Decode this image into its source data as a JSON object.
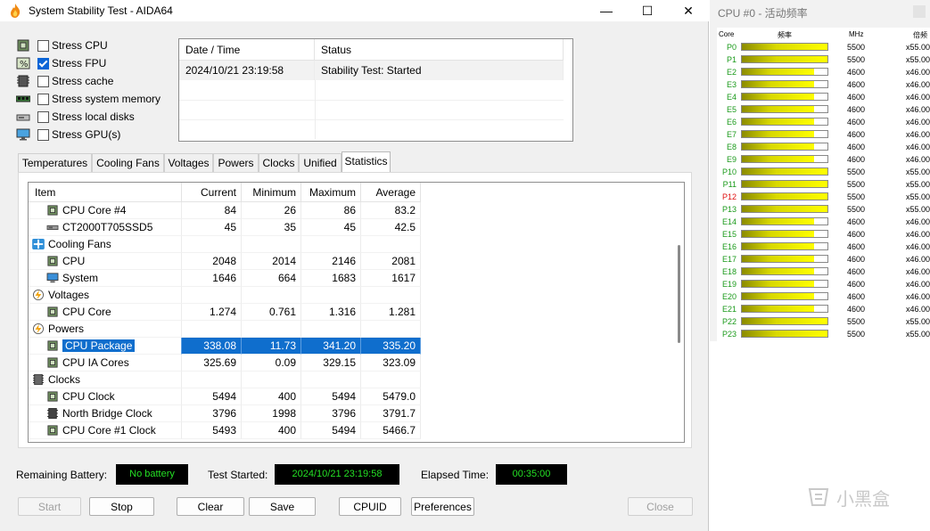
{
  "window": {
    "title": "System Stability Test - AIDA64",
    "minimize": "—",
    "maximize": "☐",
    "close": "✕"
  },
  "stress": [
    {
      "label": "Stress CPU",
      "checked": false,
      "icon": "cpu-chip-icon"
    },
    {
      "label": "Stress FPU",
      "checked": true,
      "icon": "fpu-percent-icon"
    },
    {
      "label": "Stress cache",
      "checked": false,
      "icon": "cache-chip-icon"
    },
    {
      "label": "Stress system memory",
      "checked": false,
      "icon": "memory-module-icon"
    },
    {
      "label": "Stress local disks",
      "checked": false,
      "icon": "disk-drive-icon"
    },
    {
      "label": "Stress GPU(s)",
      "checked": false,
      "icon": "monitor-gpu-icon"
    }
  ],
  "status_table": {
    "headers": [
      "Date / Time",
      "Status"
    ],
    "rows": [
      {
        "datetime": "2024/10/21 23:19:58",
        "status": "Stability Test: Started"
      }
    ]
  },
  "tabs": [
    "Temperatures",
    "Cooling Fans",
    "Voltages",
    "Powers",
    "Clocks",
    "Unified",
    "Statistics"
  ],
  "active_tab": "Statistics",
  "stats": {
    "headers": [
      "Item",
      "Current",
      "Minimum",
      "Maximum",
      "Average"
    ],
    "rows": [
      {
        "kind": "item",
        "icon": "cpu-chip-icon",
        "item": "CPU Core #4",
        "current": "84",
        "min": "26",
        "max": "86",
        "avg": "83.2"
      },
      {
        "kind": "item",
        "icon": "ssd-icon",
        "item": "CT2000T705SSD5",
        "current": "45",
        "min": "35",
        "max": "45",
        "avg": "42.5"
      },
      {
        "kind": "group",
        "icon": "fan-icon",
        "item": "Cooling Fans"
      },
      {
        "kind": "item",
        "icon": "cpu-chip-icon",
        "item": "CPU",
        "current": "2048",
        "min": "2014",
        "max": "2146",
        "avg": "2081"
      },
      {
        "kind": "item",
        "icon": "system-monitor-icon",
        "item": "System",
        "current": "1646",
        "min": "664",
        "max": "1683",
        "avg": "1617"
      },
      {
        "kind": "group",
        "icon": "voltage-bolt-icon",
        "item": "Voltages"
      },
      {
        "kind": "item",
        "icon": "cpu-chip-icon",
        "item": "CPU Core",
        "current": "1.274",
        "min": "0.761",
        "max": "1.316",
        "avg": "1.281"
      },
      {
        "kind": "group",
        "icon": "power-bolt-icon",
        "item": "Powers"
      },
      {
        "kind": "item",
        "icon": "cpu-chip-icon",
        "item": "CPU Package",
        "current": "338.08",
        "min": "11.73",
        "max": "341.20",
        "avg": "335.20",
        "selected": true
      },
      {
        "kind": "item",
        "icon": "cpu-chip-icon",
        "item": "CPU IA Cores",
        "current": "325.69",
        "min": "0.09",
        "max": "329.15",
        "avg": "323.09"
      },
      {
        "kind": "group",
        "icon": "clock-chip-icon",
        "item": "Clocks"
      },
      {
        "kind": "item",
        "icon": "cpu-chip-icon",
        "item": "CPU Clock",
        "current": "5494",
        "min": "400",
        "max": "5494",
        "avg": "5479.0"
      },
      {
        "kind": "item",
        "icon": "chipset-icon",
        "item": "North Bridge Clock",
        "current": "3796",
        "min": "1998",
        "max": "3796",
        "avg": "3791.7"
      },
      {
        "kind": "item",
        "icon": "cpu-chip-icon",
        "item": "CPU Core #1 Clock",
        "current": "5493",
        "min": "400",
        "max": "5494",
        "avg": "5466.7"
      }
    ]
  },
  "bottom": {
    "battery_label": "Remaining Battery:",
    "battery_value": "No battery",
    "started_label": "Test Started:",
    "started_value": "2024/10/21 23:19:58",
    "elapsed_label": "Elapsed Time:",
    "elapsed_value": "00:35:00"
  },
  "buttons": [
    {
      "label": "Start",
      "disabled": true
    },
    {
      "label": "Stop",
      "disabled": false
    },
    {
      "label": "Clear",
      "disabled": false
    },
    {
      "label": "Save",
      "disabled": false
    },
    {
      "label": "CPUID",
      "disabled": false
    },
    {
      "label": "Preferences",
      "disabled": false
    },
    {
      "label": "Close",
      "disabled": true
    }
  ],
  "monitor": {
    "title": "CPU #0 - 活动频率",
    "headers": {
      "core": "Core",
      "freq": "频率",
      "mhz": "MHz",
      "mult": "倍频"
    },
    "cores": [
      {
        "name": "P0",
        "mhz": "5500",
        "mult": "x55.00",
        "level": 1.0
      },
      {
        "name": "P1",
        "mhz": "5500",
        "mult": "x55.00",
        "level": 1.0
      },
      {
        "name": "E2",
        "mhz": "4600",
        "mult": "x46.00",
        "level": 0.84
      },
      {
        "name": "E3",
        "mhz": "4600",
        "mult": "x46.00",
        "level": 0.84
      },
      {
        "name": "E4",
        "mhz": "4600",
        "mult": "x46.00",
        "level": 0.84
      },
      {
        "name": "E5",
        "mhz": "4600",
        "mult": "x46.00",
        "level": 0.84
      },
      {
        "name": "E6",
        "mhz": "4600",
        "mult": "x46.00",
        "level": 0.84
      },
      {
        "name": "E7",
        "mhz": "4600",
        "mult": "x46.00",
        "level": 0.84
      },
      {
        "name": "E8",
        "mhz": "4600",
        "mult": "x46.00",
        "level": 0.84
      },
      {
        "name": "E9",
        "mhz": "4600",
        "mult": "x46.00",
        "level": 0.84
      },
      {
        "name": "P10",
        "mhz": "5500",
        "mult": "x55.00",
        "level": 1.0
      },
      {
        "name": "P11",
        "mhz": "5500",
        "mult": "x55.00",
        "level": 1.0
      },
      {
        "name": "P12",
        "mhz": "5500",
        "mult": "x55.00",
        "level": 1.0,
        "red": true
      },
      {
        "name": "P13",
        "mhz": "5500",
        "mult": "x55.00",
        "level": 1.0
      },
      {
        "name": "E14",
        "mhz": "4600",
        "mult": "x46.00",
        "level": 0.84
      },
      {
        "name": "E15",
        "mhz": "4600",
        "mult": "x46.00",
        "level": 0.84
      },
      {
        "name": "E16",
        "mhz": "4600",
        "mult": "x46.00",
        "level": 0.84
      },
      {
        "name": "E17",
        "mhz": "4600",
        "mult": "x46.00",
        "level": 0.84
      },
      {
        "name": "E18",
        "mhz": "4600",
        "mult": "x46.00",
        "level": 0.84
      },
      {
        "name": "E19",
        "mhz": "4600",
        "mult": "x46.00",
        "level": 0.84
      },
      {
        "name": "E20",
        "mhz": "4600",
        "mult": "x46.00",
        "level": 0.84
      },
      {
        "name": "E21",
        "mhz": "4600",
        "mult": "x46.00",
        "level": 0.84
      },
      {
        "name": "P22",
        "mhz": "5500",
        "mult": "x55.00",
        "level": 1.0
      },
      {
        "name": "P23",
        "mhz": "5500",
        "mult": "x55.00",
        "level": 1.0
      }
    ]
  },
  "watermark": "小黑盒",
  "colors": {
    "selection": "#0f6ecd",
    "led_text": "#24e024",
    "core_green": "#1a9a1a",
    "core_red": "#e01010",
    "bar_yellow": "#ffff00"
  }
}
